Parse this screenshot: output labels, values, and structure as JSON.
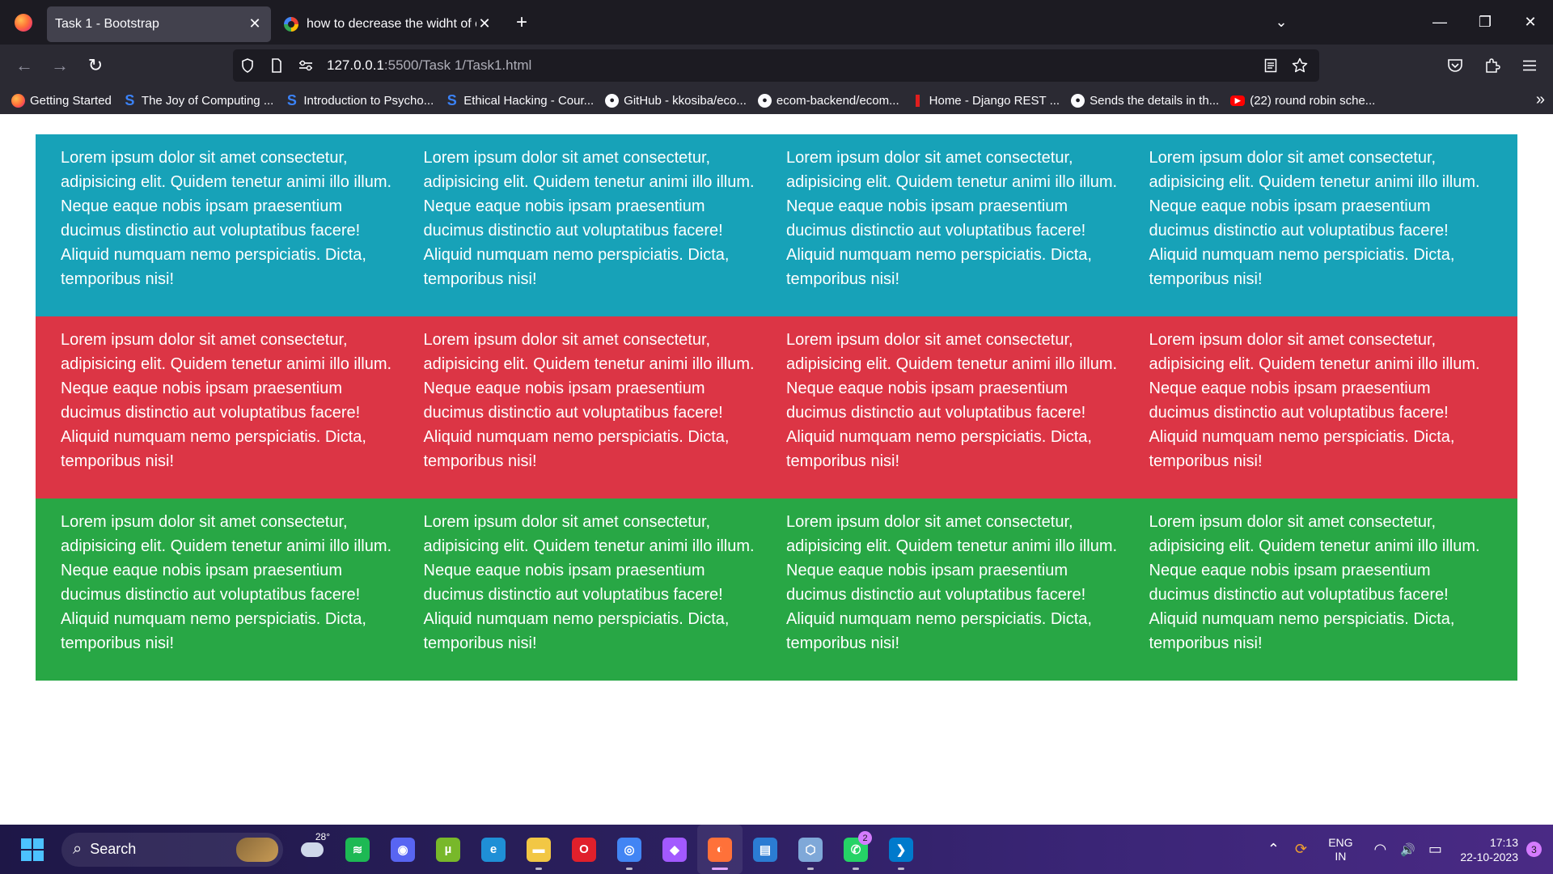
{
  "browser": {
    "tabs": [
      {
        "title": "Task 1 - Bootstrap",
        "active": true
      },
      {
        "title": "how to decrease the widht of co",
        "active": false
      }
    ],
    "new_tab_symbol": "+",
    "close_symbol": "✕",
    "list_all_tabs_symbol": "⌄",
    "window_controls": {
      "minimize": "—",
      "restore": "❐",
      "close": "✕"
    },
    "nav": {
      "back": "←",
      "forward": "→",
      "reload": "↻"
    },
    "url": {
      "host": "127.0.0.1",
      "rest": ":5500/Task 1/Task1.html"
    },
    "url_icons": [
      "shield-icon",
      "page-icon",
      "permissions-icon",
      "reader-view-icon",
      "bookmark-star-icon"
    ],
    "toolbar_icons": [
      "pocket-icon",
      "extensions-icon",
      "menu-icon"
    ],
    "bookmarks": [
      {
        "label": "Getting Started",
        "icon": "firefox-icon"
      },
      {
        "label": "The Joy of Computing ...",
        "icon": "swayam-icon"
      },
      {
        "label": "Introduction to Psycho...",
        "icon": "swayam-icon"
      },
      {
        "label": "Ethical Hacking - Cour...",
        "icon": "swayam-icon"
      },
      {
        "label": "GitHub - kkosiba/eco...",
        "icon": "github-icon"
      },
      {
        "label": "ecom-backend/ecom...",
        "icon": "github-icon"
      },
      {
        "label": "Home - Django REST ...",
        "icon": "django-icon"
      },
      {
        "label": "Sends the details in th...",
        "icon": "github-icon"
      },
      {
        "label": "(22) round robin sche...",
        "icon": "youtube-icon"
      }
    ],
    "bookmarks_more": "»"
  },
  "page": {
    "colors": {
      "info": "#17a2b8",
      "danger": "#dc3545",
      "success": "#28a745"
    },
    "rows": [
      {
        "color": "info",
        "cols": [
          "Lorem ipsum dolor sit amet consectetur, adipisicing elit. Quidem tenetur animi illo illum. Neque eaque nobis ipsam praesentium ducimus distinctio aut voluptatibus facere! Aliquid numquam nemo perspiciatis. Dicta, temporibus nisi!",
          "Lorem ipsum dolor sit amet consectetur, adipisicing elit. Quidem tenetur animi illo illum. Neque eaque nobis ipsam praesentium ducimus distinctio aut voluptatibus facere! Aliquid numquam nemo perspiciatis. Dicta, temporibus nisi!",
          "Lorem ipsum dolor sit amet consectetur, adipisicing elit. Quidem tenetur animi illo illum. Neque eaque nobis ipsam praesentium ducimus distinctio aut voluptatibus facere! Aliquid numquam nemo perspiciatis. Dicta, temporibus nisi!",
          "Lorem ipsum dolor sit amet consectetur, adipisicing elit. Quidem tenetur animi illo illum. Neque eaque nobis ipsam praesentium ducimus distinctio aut voluptatibus facere! Aliquid numquam nemo perspiciatis. Dicta, temporibus nisi!"
        ]
      },
      {
        "color": "danger",
        "cols": [
          "Lorem ipsum dolor sit amet consectetur, adipisicing elit. Quidem tenetur animi illo illum. Neque eaque nobis ipsam praesentium ducimus distinctio aut voluptatibus facere! Aliquid numquam nemo perspiciatis. Dicta, temporibus nisi!",
          "Lorem ipsum dolor sit amet consectetur, adipisicing elit. Quidem tenetur animi illo illum. Neque eaque nobis ipsam praesentium ducimus distinctio aut voluptatibus facere! Aliquid numquam nemo perspiciatis. Dicta, temporibus nisi!",
          "Lorem ipsum dolor sit amet consectetur, adipisicing elit. Quidem tenetur animi illo illum. Neque eaque nobis ipsam praesentium ducimus distinctio aut voluptatibus facere! Aliquid numquam nemo perspiciatis. Dicta, temporibus nisi!",
          "Lorem ipsum dolor sit amet consectetur, adipisicing elit. Quidem tenetur animi illo illum. Neque eaque nobis ipsam praesentium ducimus distinctio aut voluptatibus facere! Aliquid numquam nemo perspiciatis. Dicta, temporibus nisi!"
        ]
      },
      {
        "color": "success",
        "cols": [
          "Lorem ipsum dolor sit amet consectetur, adipisicing elit. Quidem tenetur animi illo illum. Neque eaque nobis ipsam praesentium ducimus distinctio aut voluptatibus facere! Aliquid numquam nemo perspiciatis. Dicta, temporibus nisi!",
          "Lorem ipsum dolor sit amet consectetur, adipisicing elit. Quidem tenetur animi illo illum. Neque eaque nobis ipsam praesentium ducimus distinctio aut voluptatibus facere! Aliquid numquam nemo perspiciatis. Dicta, temporibus nisi!",
          "Lorem ipsum dolor sit amet consectetur, adipisicing elit. Quidem tenetur animi illo illum. Neque eaque nobis ipsam praesentium ducimus distinctio aut voluptatibus facere! Aliquid numquam nemo perspiciatis. Dicta, temporibus nisi!",
          "Lorem ipsum dolor sit amet consectetur, adipisicing elit. Quidem tenetur animi illo illum. Neque eaque nobis ipsam praesentium ducimus distinctio aut voluptatibus facere! Aliquid numquam nemo perspiciatis. Dicta, temporibus nisi!"
        ]
      }
    ]
  },
  "taskbar": {
    "search_placeholder": "Search",
    "search_icon": "⌕",
    "weather_temp": "28°",
    "apps": [
      {
        "name": "spotify-icon",
        "glyph": "≋",
        "color": "#1db954",
        "running": false,
        "badge": ""
      },
      {
        "name": "discord-icon",
        "glyph": "◉",
        "color": "#5865f2",
        "running": false,
        "badge": ""
      },
      {
        "name": "utorrent-icon",
        "glyph": "µ",
        "color": "#78b82a",
        "running": false,
        "badge": ""
      },
      {
        "name": "edge-icon",
        "glyph": "e",
        "color": "#1f8fd6",
        "running": false,
        "badge": ""
      },
      {
        "name": "file-explorer-icon",
        "glyph": "▬",
        "color": "#f2c744",
        "running": true,
        "badge": ""
      },
      {
        "name": "opera-icon",
        "glyph": "O",
        "color": "#e0202b",
        "running": false,
        "badge": ""
      },
      {
        "name": "chrome-icon",
        "glyph": "◎",
        "color": "#4285f4",
        "running": true,
        "badge": ""
      },
      {
        "name": "figma-icon",
        "glyph": "◆",
        "color": "#a259ff",
        "running": false,
        "badge": ""
      },
      {
        "name": "firefox-icon",
        "glyph": "◐",
        "color": "#ff7139",
        "running": true,
        "active": true,
        "badge": ""
      },
      {
        "name": "word-icon",
        "glyph": "▤",
        "color": "#2b7cd3",
        "running": false,
        "badge": ""
      },
      {
        "name": "virtualbox-icon",
        "glyph": "⬡",
        "color": "#7fa8d8",
        "running": true,
        "badge": ""
      },
      {
        "name": "whatsapp-icon",
        "glyph": "✆",
        "color": "#25d366",
        "running": true,
        "badge": "2"
      },
      {
        "name": "vscode-icon",
        "glyph": "❯",
        "color": "#007acc",
        "running": true,
        "badge": ""
      }
    ],
    "tray": {
      "chevron": "⌃",
      "sync": "⟳",
      "lang_line1": "ENG",
      "lang_line2": "IN",
      "wifi": "◠",
      "volume": "🔊",
      "battery": "▭",
      "time": "17:13",
      "date": "22-10-2023",
      "notifications": "3"
    }
  }
}
